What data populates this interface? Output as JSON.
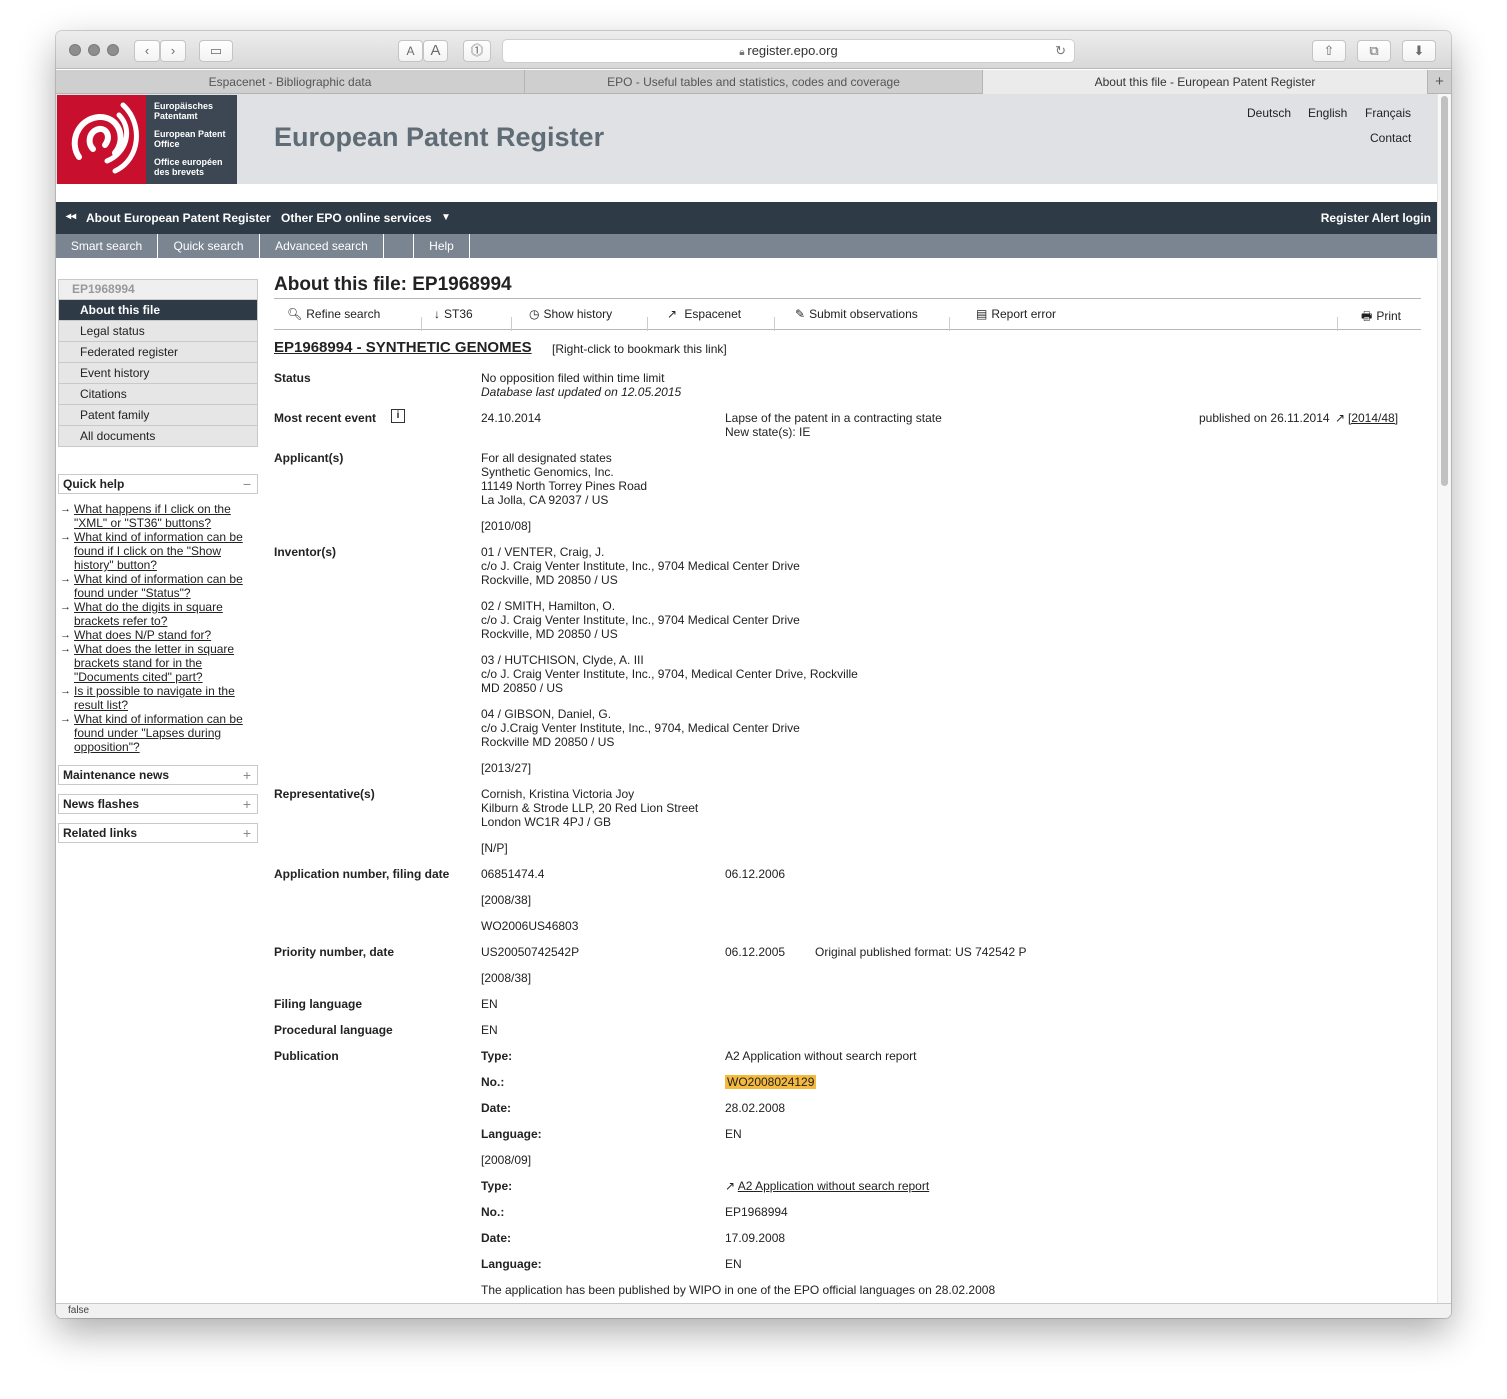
{
  "browser": {
    "url": "register.epo.org",
    "tabs": [
      {
        "label": "Espacenet - Bibliographic data"
      },
      {
        "label": "EPO - Useful tables and statistics, codes and coverage"
      },
      {
        "label": "About this file - European Patent Register"
      }
    ],
    "status_text": "false"
  },
  "header": {
    "logo_lines": [
      "Europäisches Patentamt",
      "European Patent Office",
      "Office européen des brevets"
    ],
    "title": "European Patent Register",
    "languages": [
      "Deutsch",
      "English",
      "Français"
    ],
    "contact": "Contact"
  },
  "nav": {
    "about": "About European Patent Register",
    "other": "Other EPO online services",
    "alert_login": "Register Alert login",
    "sub": [
      "Smart search",
      "Quick search",
      "Advanced search",
      "",
      "Help"
    ]
  },
  "sidebar": {
    "file_id": "EP1968994",
    "items": [
      "About this file",
      "Legal status",
      "Federated register",
      "Event history",
      "Citations",
      "Patent family",
      "All documents"
    ],
    "quick_help_title": "Quick help",
    "quick_help_links": [
      "What happens if I click on the \"XML\" or \"ST36\" buttons?",
      "What kind of information can be found if I click on the \"Show history\" button?",
      "What kind of information can be found under \"Status\"?",
      "What do the digits in square brackets refer to?",
      "What does N/P stand for?",
      "What does the letter in square brackets stand for in the \"Documents cited\" part?",
      "Is it possible to navigate in the result list?",
      "What kind of information can be found under \"Lapses during opposition\"?"
    ],
    "panels": [
      "Maintenance news",
      "News flashes",
      "Related links"
    ]
  },
  "main": {
    "heading": "About this file: EP1968994",
    "actions": [
      "Refine search",
      "ST36",
      "Show history",
      "Espacenet",
      "Submit observations",
      "Report error",
      "Print"
    ],
    "title_link": "EP1968994 - SYNTHETIC GENOMES",
    "title_note": "[Right-click to bookmark this link]",
    "status": {
      "label": "Status",
      "value": "No opposition filed within time limit",
      "updated": "Database last updated on 12.05.2015"
    },
    "recent_event": {
      "label": "Most recent event",
      "date": "24.10.2014",
      "desc": "Lapse of the patent in a contracting state",
      "new_states": "New state(s): IE",
      "published": "published on 26.11.2014",
      "bulletin": "[2014/48]"
    },
    "applicants": {
      "label": "Applicant(s)",
      "lines": [
        "For all designated states",
        "Synthetic Genomics, Inc.",
        "11149 North Torrey Pines Road",
        "La Jolla, CA 92037 / US"
      ],
      "ref": "[2010/08]"
    },
    "inventors": {
      "label": "Inventor(s)",
      "list": [
        [
          "01 / VENTER, Craig, J.",
          "c/o J. Craig Venter Institute, Inc., 9704 Medical Center Drive",
          "Rockville, MD 20850 / US"
        ],
        [
          "02 / SMITH, Hamilton, O.",
          "c/o J. Craig Venter Institute, Inc., 9704 Medical Center Drive",
          "Rockville, MD 20850 / US"
        ],
        [
          "03 / HUTCHISON, Clyde, A. III",
          "c/o J. Craig Venter Institute, Inc., 9704, Medical Center Drive, Rockville",
          "MD 20850 / US"
        ],
        [
          "04 / GIBSON, Daniel, G.",
          "c/o J.Craig Venter Institute, Inc., 9704, Medical Center Drive",
          "Rockville MD 20850 / US"
        ]
      ],
      "ref": "[2013/27]"
    },
    "representative": {
      "label": "Representative(s)",
      "lines": [
        "Cornish, Kristina Victoria Joy",
        "Kilburn & Strode LLP, 20 Red Lion Street",
        "London WC1R 4PJ / GB"
      ],
      "ref": "[N/P]"
    },
    "application": {
      "label": "Application number, filing date",
      "number": "06851474.4",
      "date": "06.12.2006",
      "ref": "[2008/38]",
      "wo": "WO2006US46803"
    },
    "priority": {
      "label": "Priority number, date",
      "number": "US20050742542P",
      "date": "06.12.2005",
      "orig": "Original published format: US 742542 P",
      "ref": "[2008/38]"
    },
    "filing_language": {
      "label": "Filing language",
      "value": "EN"
    },
    "procedural_language": {
      "label": "Procedural language",
      "value": "EN"
    },
    "publication": {
      "label": "Publication",
      "type_lbl": "Type:",
      "no_lbl": "No.:",
      "date_lbl": "Date:",
      "lang_lbl": "Language:",
      "p1": {
        "type": "A2  Application without search report",
        "no": "WO2008024129",
        "date": "28.02.2008",
        "lang": "EN",
        "ref": "[2008/09]"
      },
      "p2": {
        "type": "A2 Application without search report",
        "no": "EP1968994",
        "date": "17.09.2008",
        "lang": "EN"
      },
      "note": "The application has been published by WIPO in one of the EPO official languages on 28.02.2008"
    }
  }
}
